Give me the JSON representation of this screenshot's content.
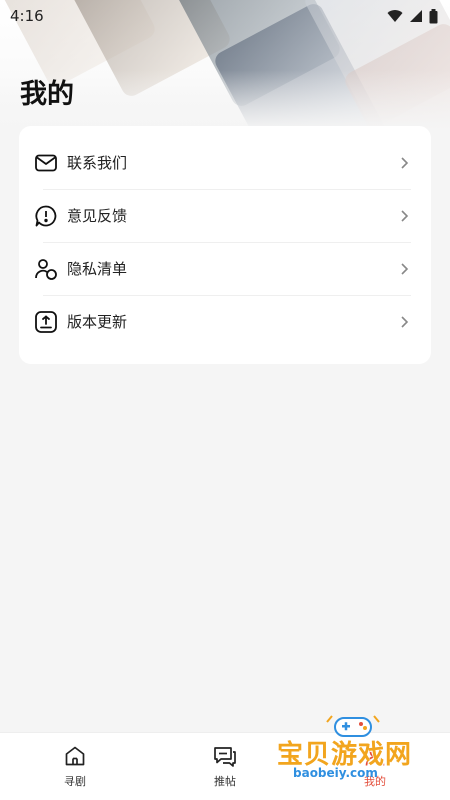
{
  "status_bar": {
    "time": "4:16"
  },
  "page": {
    "title": "我的"
  },
  "menu": {
    "items": [
      {
        "label": "联系我们",
        "icon": "mail-icon"
      },
      {
        "label": "意见反馈",
        "icon": "feedback-icon"
      },
      {
        "label": "隐私清单",
        "icon": "privacy-icon"
      },
      {
        "label": "版本更新",
        "icon": "update-icon"
      }
    ]
  },
  "tabbar": {
    "tabs": [
      {
        "label": "寻剧",
        "icon": "home-icon"
      },
      {
        "label": "推帖",
        "icon": "posts-icon"
      },
      {
        "label": "我的",
        "icon": "profile-icon",
        "active": true
      }
    ]
  },
  "watermark": {
    "text": "宝贝游戏网",
    "url": "baobeiy.com"
  },
  "colors": {
    "accent": "#e34f3c",
    "card": "#ffffff",
    "background": "#f5f5f5"
  }
}
